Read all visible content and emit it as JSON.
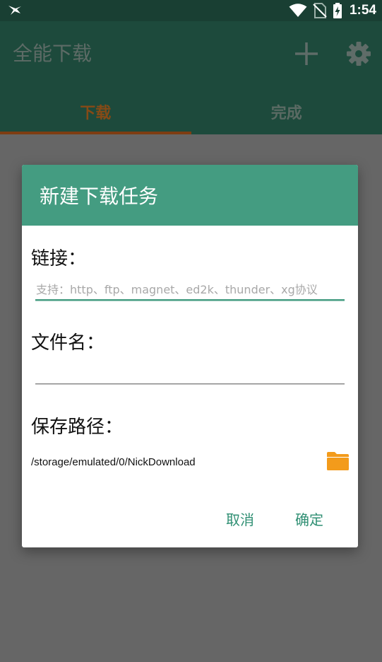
{
  "status_bar": {
    "time": "1:54",
    "icons": [
      "notification-bird-icon",
      "wifi-icon",
      "no-sim-icon",
      "battery-charging-icon"
    ]
  },
  "app_bar": {
    "title": "全能下载",
    "actions": [
      "plus-icon",
      "gear-icon"
    ]
  },
  "tabs": [
    {
      "label": "下载",
      "active": true
    },
    {
      "label": "完成",
      "active": false
    }
  ],
  "dialog": {
    "title": "新建下载任务",
    "link": {
      "label": "链接：",
      "value": "",
      "placeholder": "支持：http、ftp、magnet、ed2k、thunder、xg协议"
    },
    "filename": {
      "label": "文件名：",
      "value": ""
    },
    "save_path": {
      "label": "保存路径：",
      "value": "/storage/emulated/0/NickDownload",
      "icon": "folder-icon"
    },
    "cancel_label": "取消",
    "confirm_label": "确定"
  },
  "colors": {
    "accent": "#449c81",
    "app_bar": "#1d4a3c",
    "status_bar": "#193f33",
    "tab_indicator": "#7e3d12",
    "folder": "#f39b1b",
    "scrim": "#666666"
  }
}
